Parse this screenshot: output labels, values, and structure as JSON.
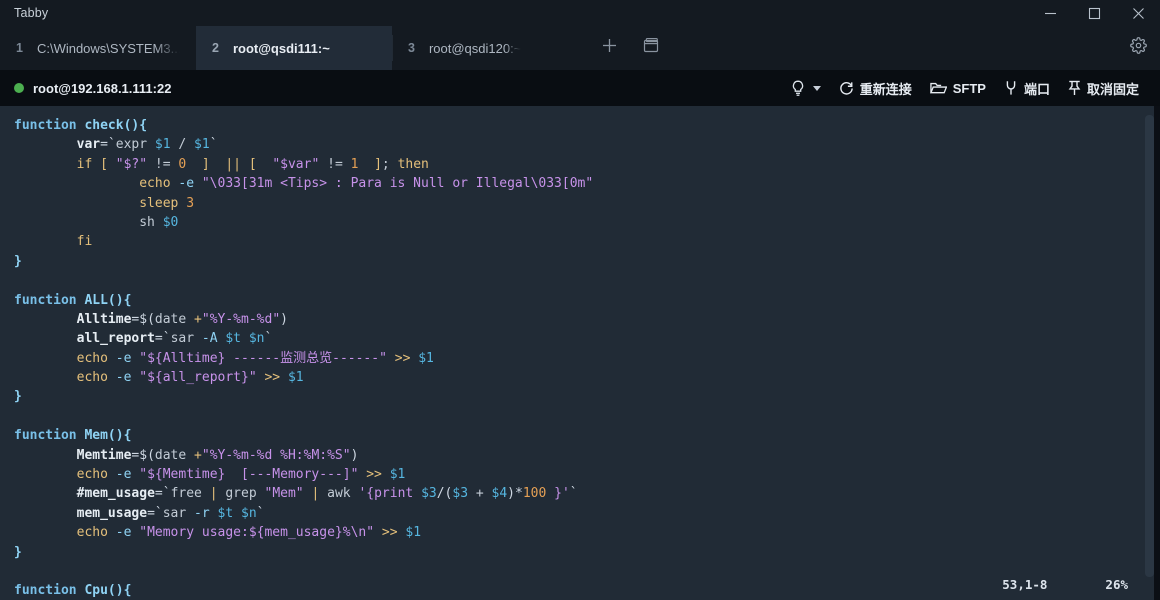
{
  "window": {
    "app_title": "Tabby",
    "controls": [
      {
        "name": "minimize",
        "glyph": "minimize-icon"
      },
      {
        "name": "maximize",
        "glyph": "maximize-icon"
      },
      {
        "name": "close",
        "glyph": "close-icon"
      }
    ]
  },
  "tabs": [
    {
      "number": "1",
      "label": "C:\\Windows\\SYSTEM3...",
      "active": false
    },
    {
      "number": "2",
      "label": "root@qsdi111:~",
      "active": true
    },
    {
      "number": "3",
      "label": "root@qsdi120:~",
      "active": false
    }
  ],
  "tabbar": {
    "new_tab_label": "+",
    "new_tab_icon": "plus-icon",
    "split_icon": "window-split-icon",
    "settings_icon": "gear-icon"
  },
  "toolbar": {
    "host": "root@192.168.1.111:22",
    "status_color": "#4caf50",
    "items": [
      {
        "label": "",
        "icon": "lightbulb-icon",
        "has_caret": true
      },
      {
        "label": "重新连接",
        "icon": "reconnect-icon",
        "has_caret": false
      },
      {
        "label": "SFTP",
        "icon": "folder-icon",
        "has_caret": false
      },
      {
        "label": "端口",
        "icon": "plug-icon",
        "has_caret": false
      },
      {
        "label": "取消固定",
        "icon": "pin-icon",
        "has_caret": false
      }
    ]
  },
  "terminal": {
    "background": "#212b36",
    "status_position": "53,1-8",
    "status_percent": "26%",
    "lines": [
      [
        {
          "t": "function ",
          "c": "kw"
        },
        {
          "t": "check(){",
          "c": "fn"
        }
      ],
      [
        {
          "t": "        ",
          "c": "plain"
        },
        {
          "t": "var",
          "c": "vr"
        },
        {
          "t": "=",
          "c": "punc"
        },
        {
          "t": "`",
          "c": "punc"
        },
        {
          "t": "expr ",
          "c": "plain"
        },
        {
          "t": "$1",
          "c": "var"
        },
        {
          "t": " / ",
          "c": "plain"
        },
        {
          "t": "$1",
          "c": "var"
        },
        {
          "t": "`",
          "c": "punc"
        }
      ],
      [
        {
          "t": "        ",
          "c": "plain"
        },
        {
          "t": "if",
          "c": "cmd"
        },
        {
          "t": " ",
          "c": "plain"
        },
        {
          "t": "[",
          "c": "op"
        },
        {
          "t": " ",
          "c": "plain"
        },
        {
          "t": "\"$?\"",
          "c": "str"
        },
        {
          "t": " != ",
          "c": "plain"
        },
        {
          "t": "0",
          "c": "num"
        },
        {
          "t": "  ",
          "c": "plain"
        },
        {
          "t": "]",
          "c": "op"
        },
        {
          "t": "  ",
          "c": "plain"
        },
        {
          "t": "||",
          "c": "op"
        },
        {
          "t": " ",
          "c": "plain"
        },
        {
          "t": "[",
          "c": "op"
        },
        {
          "t": "  ",
          "c": "plain"
        },
        {
          "t": "\"$var\"",
          "c": "str"
        },
        {
          "t": " != ",
          "c": "plain"
        },
        {
          "t": "1",
          "c": "num"
        },
        {
          "t": "  ",
          "c": "plain"
        },
        {
          "t": "]",
          "c": "op"
        },
        {
          "t": "; ",
          "c": "plain"
        },
        {
          "t": "then",
          "c": "cmd"
        }
      ],
      [
        {
          "t": "                ",
          "c": "plain"
        },
        {
          "t": "echo",
          "c": "cmd"
        },
        {
          "t": " ",
          "c": "plain"
        },
        {
          "t": "-e",
          "c": "flag"
        },
        {
          "t": " ",
          "c": "plain"
        },
        {
          "t": "\"\\033[31m <Tips> : Para is Null or Illegal\\033[0m\"",
          "c": "str"
        }
      ],
      [
        {
          "t": "                ",
          "c": "plain"
        },
        {
          "t": "sleep",
          "c": "cmd"
        },
        {
          "t": " ",
          "c": "plain"
        },
        {
          "t": "3",
          "c": "num"
        }
      ],
      [
        {
          "t": "                ",
          "c": "plain"
        },
        {
          "t": "sh ",
          "c": "plain"
        },
        {
          "t": "$0",
          "c": "var"
        }
      ],
      [
        {
          "t": "        ",
          "c": "plain"
        },
        {
          "t": "fi",
          "c": "cmd"
        }
      ],
      [
        {
          "t": "}",
          "c": "fn"
        }
      ],
      [
        {
          "t": "",
          "c": "plain"
        }
      ],
      [
        {
          "t": "function ",
          "c": "kw"
        },
        {
          "t": "ALL(){",
          "c": "fn"
        }
      ],
      [
        {
          "t": "        ",
          "c": "plain"
        },
        {
          "t": "Alltime",
          "c": "vr"
        },
        {
          "t": "=$(",
          "c": "punc"
        },
        {
          "t": "date ",
          "c": "plain"
        },
        {
          "t": "+",
          "c": "op"
        },
        {
          "t": "\"%Y-%m-%d\"",
          "c": "str"
        },
        {
          "t": ")",
          "c": "punc"
        }
      ],
      [
        {
          "t": "        ",
          "c": "plain"
        },
        {
          "t": "all_report",
          "c": "vr"
        },
        {
          "t": "=",
          "c": "punc"
        },
        {
          "t": "`",
          "c": "punc"
        },
        {
          "t": "sar ",
          "c": "plain"
        },
        {
          "t": "-A",
          "c": "flag"
        },
        {
          "t": " ",
          "c": "plain"
        },
        {
          "t": "$t",
          "c": "var"
        },
        {
          "t": " ",
          "c": "plain"
        },
        {
          "t": "$n",
          "c": "var"
        },
        {
          "t": "`",
          "c": "punc"
        }
      ],
      [
        {
          "t": "        ",
          "c": "plain"
        },
        {
          "t": "echo",
          "c": "cmd"
        },
        {
          "t": " ",
          "c": "plain"
        },
        {
          "t": "-e",
          "c": "flag"
        },
        {
          "t": " ",
          "c": "plain"
        },
        {
          "t": "\"${Alltime} ------监测总览------\"",
          "c": "str"
        },
        {
          "t": " ",
          "c": "plain"
        },
        {
          "t": ">>",
          "c": "op"
        },
        {
          "t": " ",
          "c": "plain"
        },
        {
          "t": "$1",
          "c": "var"
        }
      ],
      [
        {
          "t": "        ",
          "c": "plain"
        },
        {
          "t": "echo",
          "c": "cmd"
        },
        {
          "t": " ",
          "c": "plain"
        },
        {
          "t": "-e",
          "c": "flag"
        },
        {
          "t": " ",
          "c": "plain"
        },
        {
          "t": "\"${all_report}\"",
          "c": "str"
        },
        {
          "t": " ",
          "c": "plain"
        },
        {
          "t": ">>",
          "c": "op"
        },
        {
          "t": " ",
          "c": "plain"
        },
        {
          "t": "$1",
          "c": "var"
        }
      ],
      [
        {
          "t": "}",
          "c": "fn"
        }
      ],
      [
        {
          "t": "",
          "c": "plain"
        }
      ],
      [
        {
          "t": "function ",
          "c": "kw"
        },
        {
          "t": "Mem(){",
          "c": "fn"
        }
      ],
      [
        {
          "t": "        ",
          "c": "plain"
        },
        {
          "t": "Memtime",
          "c": "vr"
        },
        {
          "t": "=$(",
          "c": "punc"
        },
        {
          "t": "date ",
          "c": "plain"
        },
        {
          "t": "+",
          "c": "op"
        },
        {
          "t": "\"%Y-%m-%d %H:%M:%S\"",
          "c": "str"
        },
        {
          "t": ")",
          "c": "punc"
        }
      ],
      [
        {
          "t": "        ",
          "c": "plain"
        },
        {
          "t": "echo",
          "c": "cmd"
        },
        {
          "t": " ",
          "c": "plain"
        },
        {
          "t": "-e",
          "c": "flag"
        },
        {
          "t": " ",
          "c": "plain"
        },
        {
          "t": "\"${Memtime}  [---Memory---]\"",
          "c": "str"
        },
        {
          "t": " ",
          "c": "plain"
        },
        {
          "t": ">>",
          "c": "op"
        },
        {
          "t": " ",
          "c": "plain"
        },
        {
          "t": "$1",
          "c": "var"
        }
      ],
      [
        {
          "t": "        ",
          "c": "plain"
        },
        {
          "t": "#mem_usage",
          "c": "vr"
        },
        {
          "t": "=",
          "c": "punc"
        },
        {
          "t": "`",
          "c": "punc"
        },
        {
          "t": "free ",
          "c": "plain"
        },
        {
          "t": "| ",
          "c": "op"
        },
        {
          "t": "grep ",
          "c": "plain"
        },
        {
          "t": "\"Mem\"",
          "c": "str"
        },
        {
          "t": " ",
          "c": "plain"
        },
        {
          "t": "| ",
          "c": "op"
        },
        {
          "t": "awk ",
          "c": "plain"
        },
        {
          "t": "'{print ",
          "c": "str"
        },
        {
          "t": "$3",
          "c": "var"
        },
        {
          "t": "/(",
          "c": "punc"
        },
        {
          "t": "$3",
          "c": "var"
        },
        {
          "t": " + ",
          "c": "plain"
        },
        {
          "t": "$4",
          "c": "var"
        },
        {
          "t": ")*",
          "c": "punc"
        },
        {
          "t": "100",
          "c": "num"
        },
        {
          "t": " }'",
          "c": "str"
        },
        {
          "t": "`",
          "c": "punc"
        }
      ],
      [
        {
          "t": "        ",
          "c": "plain"
        },
        {
          "t": "mem_usage",
          "c": "vr"
        },
        {
          "t": "=",
          "c": "punc"
        },
        {
          "t": "`",
          "c": "punc"
        },
        {
          "t": "sar ",
          "c": "plain"
        },
        {
          "t": "-r",
          "c": "flag"
        },
        {
          "t": " ",
          "c": "plain"
        },
        {
          "t": "$t",
          "c": "var"
        },
        {
          "t": " ",
          "c": "plain"
        },
        {
          "t": "$n",
          "c": "var"
        },
        {
          "t": "`",
          "c": "punc"
        }
      ],
      [
        {
          "t": "        ",
          "c": "plain"
        },
        {
          "t": "echo",
          "c": "cmd"
        },
        {
          "t": " ",
          "c": "plain"
        },
        {
          "t": "-e",
          "c": "flag"
        },
        {
          "t": " ",
          "c": "plain"
        },
        {
          "t": "\"Memory usage:${mem_usage}%\\n\"",
          "c": "str"
        },
        {
          "t": " ",
          "c": "plain"
        },
        {
          "t": ">>",
          "c": "op"
        },
        {
          "t": " ",
          "c": "plain"
        },
        {
          "t": "$1",
          "c": "var"
        }
      ],
      [
        {
          "t": "}",
          "c": "fn"
        }
      ],
      [
        {
          "t": "",
          "c": "plain"
        }
      ],
      [
        {
          "t": "function ",
          "c": "kw"
        },
        {
          "t": "Cpu(){",
          "c": "fn"
        }
      ]
    ]
  }
}
